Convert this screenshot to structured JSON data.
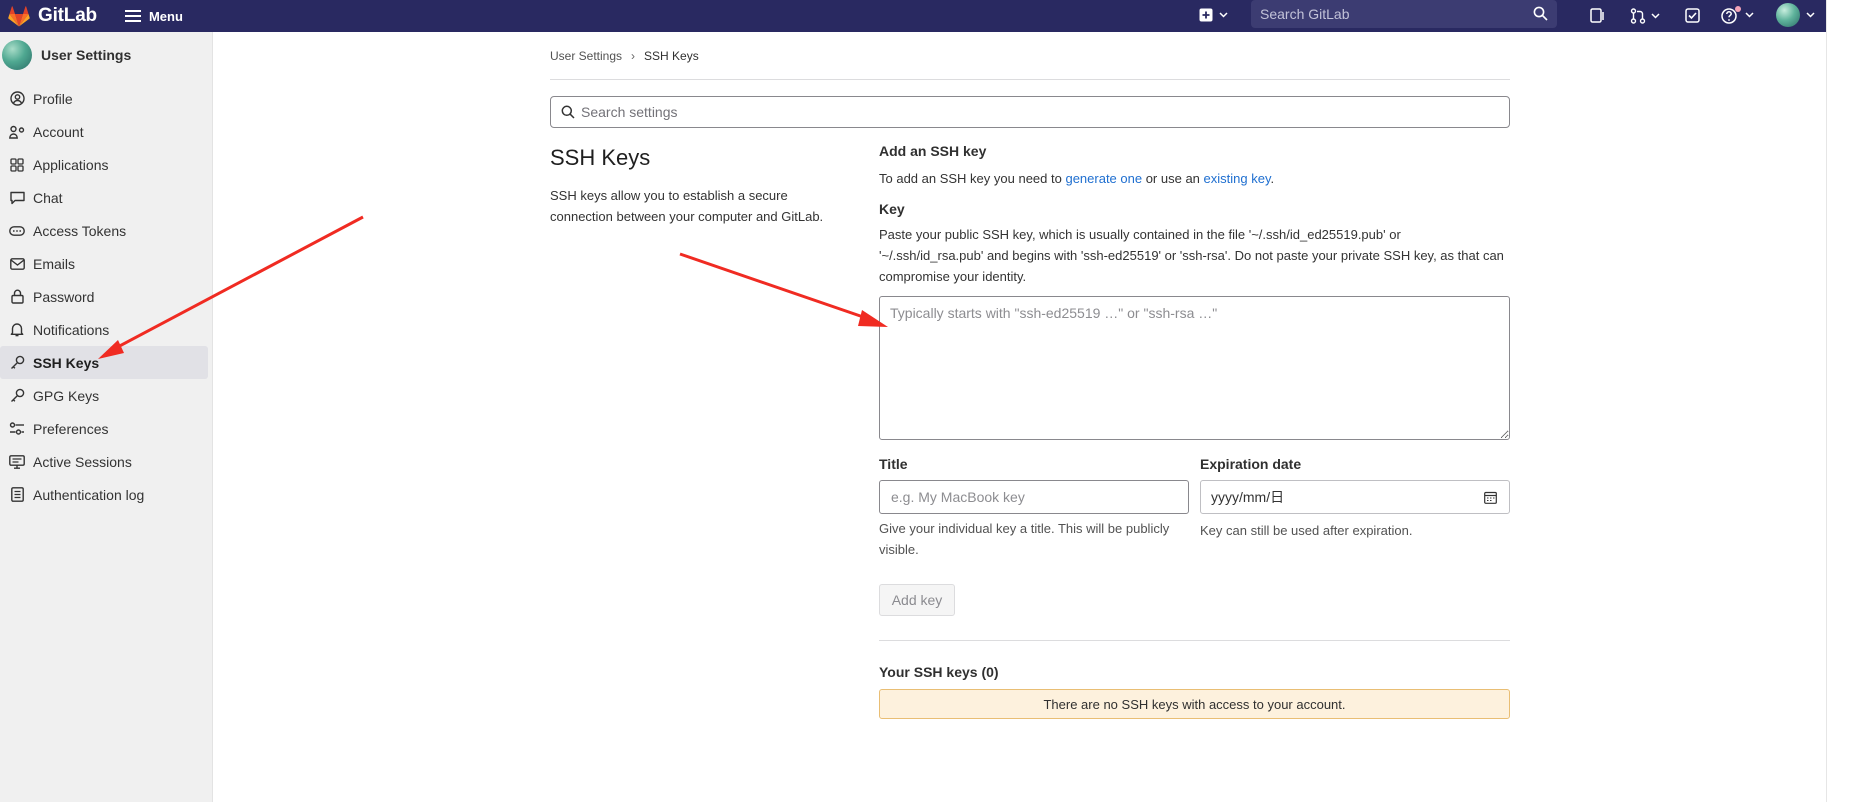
{
  "topbar": {
    "brand": "GitLab",
    "menu_label": "Menu",
    "search_placeholder": "Search GitLab",
    "icons": [
      "plus-square-icon",
      "chevron-down-icon",
      "search-icon",
      "issues-icon",
      "merge-request-icon",
      "todo-icon",
      "help-icon",
      "avatar"
    ]
  },
  "sidebar": {
    "title": "User Settings",
    "items": [
      {
        "label": "Profile",
        "icon": "profile-icon"
      },
      {
        "label": "Account",
        "icon": "account-icon"
      },
      {
        "label": "Applications",
        "icon": "applications-icon"
      },
      {
        "label": "Chat",
        "icon": "chat-icon"
      },
      {
        "label": "Access Tokens",
        "icon": "token-icon"
      },
      {
        "label": "Emails",
        "icon": "mail-icon"
      },
      {
        "label": "Password",
        "icon": "lock-icon"
      },
      {
        "label": "Notifications",
        "icon": "bell-icon"
      },
      {
        "label": "SSH Keys",
        "icon": "key-icon",
        "active": true
      },
      {
        "label": "GPG Keys",
        "icon": "key-icon"
      },
      {
        "label": "Preferences",
        "icon": "preferences-icon"
      },
      {
        "label": "Active Sessions",
        "icon": "monitor-icon"
      },
      {
        "label": "Authentication log",
        "icon": "log-icon"
      }
    ]
  },
  "breadcrumb": {
    "parent": "User Settings",
    "separator": "›",
    "current": "SSH Keys"
  },
  "settings_search": {
    "placeholder": "Search settings"
  },
  "section": {
    "title": "SSH Keys",
    "description": "SSH keys allow you to establish a secure connection between your computer and GitLab."
  },
  "form": {
    "heading": "Add an SSH key",
    "intro_prefix": "To add an SSH key you need to ",
    "link_generate": "generate one",
    "intro_middle": " or use an ",
    "link_existing": "existing key",
    "intro_suffix": ".",
    "key_label": "Key",
    "key_help": "Paste your public SSH key, which is usually contained in the file '~/.ssh/id_ed25519.pub' or '~/.ssh/id_rsa.pub' and begins with 'ssh-ed25519' or 'ssh-rsa'. Do not paste your private SSH key, as that can compromise your identity.",
    "key_placeholder": "Typically starts with \"ssh-ed25519 …\" or \"ssh-rsa …\"",
    "title_label": "Title",
    "title_placeholder": "e.g. My MacBook key",
    "title_help": "Give your individual key a title. This will be publicly visible.",
    "expiration_label": "Expiration date",
    "expiration_value": "yyyy/mm/日",
    "expiration_help": "Key can still be used after expiration.",
    "add_button": "Add key"
  },
  "your_keys": {
    "heading": "Your SSH keys (0)",
    "empty_message": "There are no SSH keys with access to your account."
  },
  "colors": {
    "topbar": "#292961",
    "link": "#1f6fd0",
    "annotation_arrow": "#f02b22",
    "alert_bg": "#fdf1dd",
    "alert_border": "#e9be74"
  }
}
